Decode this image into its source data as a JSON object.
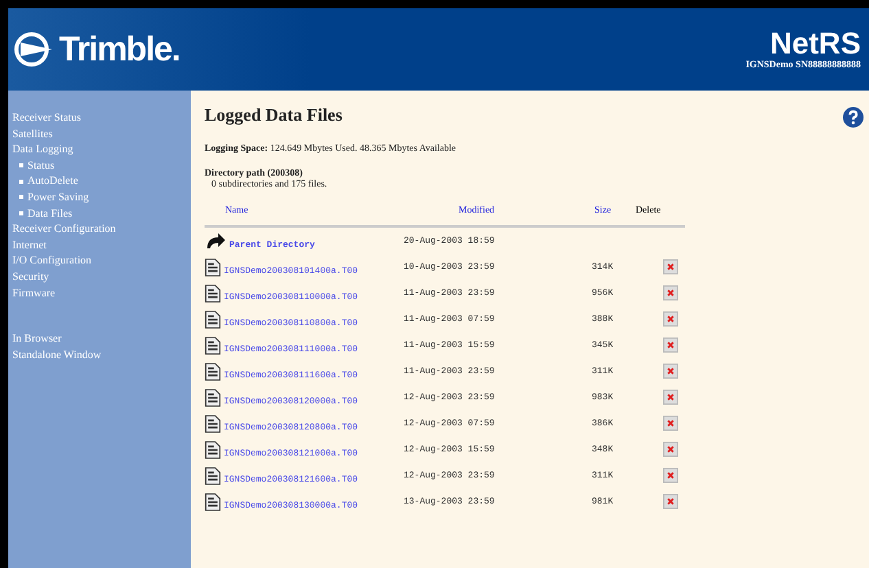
{
  "header": {
    "logo": "Trimble.",
    "product": "NetRS",
    "device": "IGNSDemo SN88888888888"
  },
  "sidebar": {
    "items": [
      {
        "label": "Receiver Status"
      },
      {
        "label": "Satellites"
      },
      {
        "label": "Data Logging",
        "children": [
          {
            "label": "Status"
          },
          {
            "label": "AutoDelete"
          },
          {
            "label": "Power Saving"
          },
          {
            "label": "Data Files"
          }
        ]
      },
      {
        "label": "Receiver Configuration"
      },
      {
        "label": "Internet"
      },
      {
        "label": "I/O Configuration"
      },
      {
        "label": "Security"
      },
      {
        "label": "Firmware"
      }
    ],
    "footer_items": [
      {
        "label": "In Browser"
      },
      {
        "label": "Standalone Window"
      }
    ]
  },
  "page": {
    "title": "Logged Data Files",
    "logging_space": "**Logging Space:** 124.649 Mbytes Used. 48.365 Mbytes Available",
    "directory_path": "Directory path (200308)",
    "summary": "0 subdirectories and 175 files."
  },
  "table": {
    "columns": [
      "Name",
      "Modified",
      "Size",
      "Delete"
    ],
    "rows": [
      {
        "kind": "parent",
        "name": "Parent Directory",
        "modified": "20-Aug-2003 18:59"
      },
      {
        "kind": "file",
        "name": "IGNSDemo200308101400a.T00",
        "modified": "10-Aug-2003 23:59",
        "size": "314K"
      },
      {
        "kind": "file",
        "name": "IGNSDemo200308110000a.T00",
        "modified": "11-Aug-2003 23:59",
        "size": "956K"
      },
      {
        "kind": "file",
        "name": "IGNSDemo200308110800a.T00",
        "modified": "11-Aug-2003 07:59",
        "size": "388K"
      },
      {
        "kind": "file",
        "name": "IGNSDemo200308111000a.T00",
        "modified": "11-Aug-2003 15:59",
        "size": "345K"
      },
      {
        "kind": "file",
        "name": "IGNSDemo200308111600a.T00",
        "modified": "11-Aug-2003 23:59",
        "size": "311K"
      },
      {
        "kind": "file",
        "name": "IGNSDemo200308120000a.T00",
        "modified": "12-Aug-2003 23:59",
        "size": "983K"
      },
      {
        "kind": "file",
        "name": "IGNSDemo200308120800a.T00",
        "modified": "12-Aug-2003 07:59",
        "size": "386K"
      },
      {
        "kind": "file",
        "name": "IGNSDemo200308121000a.T00",
        "modified": "12-Aug-2003 15:59",
        "size": "348K"
      },
      {
        "kind": "file",
        "name": "IGNSDemo200308121600a.T00",
        "modified": "12-Aug-2003 23:59",
        "size": "311K"
      },
      {
        "kind": "file",
        "name": "IGNSDemo200308130000a.T00",
        "modified": "13-Aug-2003 23:59",
        "size": "981K"
      }
    ]
  }
}
